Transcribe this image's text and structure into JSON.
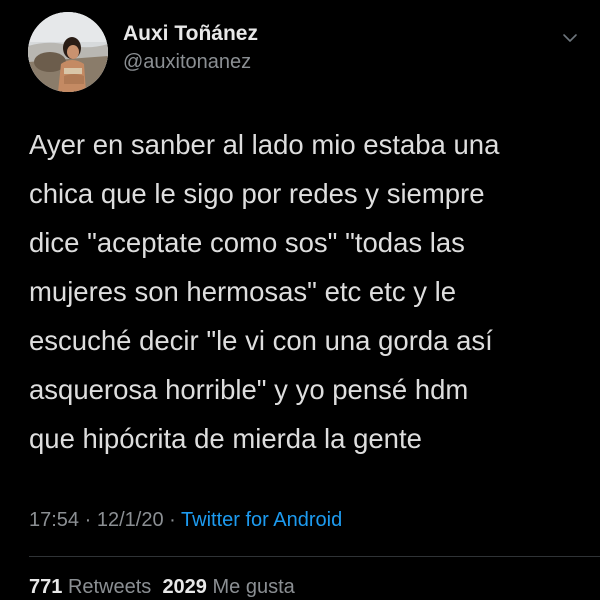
{
  "author": {
    "display_name": "Auxi Toñánez",
    "handle": "@auxitonanez",
    "avatar_icon": "profile-photo"
  },
  "tweet": {
    "lines": [
      "Ayer en sanber al lado mio estaba una",
      "chica que le sigo por redes y siempre",
      "dice \"aceptate como sos\" \"todas las",
      "mujeres son hermosas\" etc etc y le",
      "escuché decir \"le vi con una gorda así",
      "asquerosa horrible\" y yo pensé hdm",
      "que hipócrita de mierda la gente"
    ]
  },
  "meta": {
    "time": "17:54",
    "separator": "·",
    "date": "12/1/20",
    "source": "Twitter for Android"
  },
  "stats": {
    "retweets_count": "771",
    "retweets_label": "Retweets",
    "likes_count": "2029",
    "likes_label": "Me gusta"
  },
  "colors": {
    "background": "#000000",
    "text": "#dedede",
    "muted": "#8b8f93",
    "link": "#1d9bf0"
  }
}
